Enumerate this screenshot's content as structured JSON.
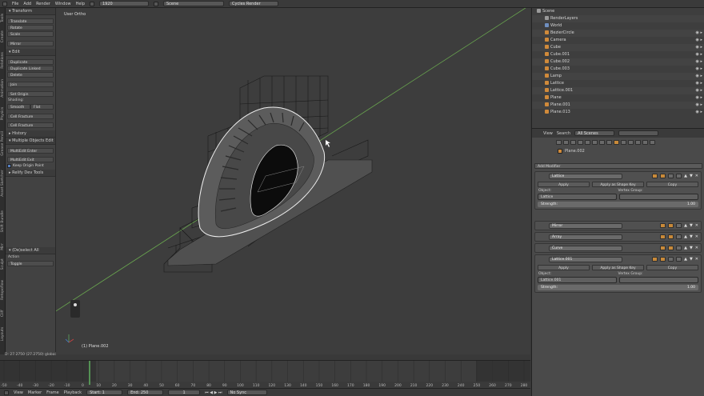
{
  "menu": {
    "items": [
      "File",
      "Add",
      "Render",
      "Window",
      "Help"
    ],
    "layout": "1920",
    "scene": "Scene",
    "engine": "Cycles Render"
  },
  "tabs": [
    "Tools",
    "Create",
    "Relations",
    "Animation",
    "Physics",
    "Grease Pencil",
    "Asset Sketcher",
    "Shift Bundle",
    "Mirr",
    "Sculpt",
    "Retopoflow",
    "Cliff",
    "Layouts",
    "Misc",
    "Layers"
  ],
  "shelf": {
    "transform": {
      "title": "Transform",
      "buttons": [
        "Translate",
        "Rotate",
        "Scale",
        "Mirror"
      ]
    },
    "edit": {
      "title": "Edit",
      "buttons": [
        "Duplicate",
        "Duplicate Linked",
        "Delete",
        "Join",
        "Set Origin"
      ],
      "shading_label": "Shading:",
      "smooth": "Smooth",
      "flat": "Flat",
      "fracture": [
        "Cell Fracture",
        "Cell Fracture"
      ]
    },
    "history": {
      "title": "History"
    },
    "multi": {
      "title": "Multiple Objects Edit",
      "buttons": [
        "MultiEdit Enter",
        "MultiEdit Exit"
      ],
      "check": "Keep Origin Point"
    },
    "relief": {
      "title": "Relify Dev Tools"
    },
    "dissolve": {
      "title": "(De)select All",
      "action_label": "Action",
      "action_value": "Toggle"
    }
  },
  "viewport": {
    "title": "User Ortho",
    "object_name": "(1) Plane.002",
    "coords": "D: 27.2750 (27.2750) global"
  },
  "timeline": {
    "ticks": [
      "-50",
      "-40",
      "-30",
      "-20",
      "-10",
      "0",
      "10",
      "20",
      "30",
      "40",
      "50",
      "60",
      "70",
      "80",
      "90",
      "100",
      "110",
      "120",
      "130",
      "140",
      "150",
      "160",
      "170",
      "180",
      "190",
      "200",
      "210",
      "220",
      "230",
      "240",
      "250",
      "260",
      "270",
      "280"
    ],
    "menu": [
      "View",
      "Marker",
      "Frame",
      "Playback"
    ],
    "start_label": "Start:",
    "start_value": "1",
    "end_label": "End:",
    "end_value": "250",
    "current": "1",
    "sync": "No Sync"
  },
  "outliner": {
    "items": [
      {
        "name": "Scene",
        "color": "#9a9a9a",
        "indent": 0
      },
      {
        "name": "RenderLayers",
        "color": "#9a9a9a",
        "indent": 1
      },
      {
        "name": "World",
        "color": "#6f8fc0",
        "indent": 1
      },
      {
        "name": "BezierCircle",
        "color": "#d08a3a",
        "indent": 1
      },
      {
        "name": "Camera",
        "color": "#d08a3a",
        "indent": 1
      },
      {
        "name": "Cube",
        "color": "#d08a3a",
        "indent": 1
      },
      {
        "name": "Cube.001",
        "color": "#d08a3a",
        "indent": 1
      },
      {
        "name": "Cube.002",
        "color": "#d08a3a",
        "indent": 1
      },
      {
        "name": "Cube.003",
        "color": "#d08a3a",
        "indent": 1
      },
      {
        "name": "Lamp",
        "color": "#d08a3a",
        "indent": 1
      },
      {
        "name": "Lattice",
        "color": "#d08a3a",
        "indent": 1
      },
      {
        "name": "Lattice.001",
        "color": "#d08a3a",
        "indent": 1
      },
      {
        "name": "Plane",
        "color": "#d08a3a",
        "indent": 1
      },
      {
        "name": "Plane.001",
        "color": "#d08a3a",
        "indent": 1
      },
      {
        "name": "Plane.013",
        "color": "#d08a3a",
        "indent": 1
      }
    ]
  },
  "propheader": {
    "view": "View",
    "search": "Search",
    "scenes": "All Scenes"
  },
  "props": {
    "object": "Plane.002",
    "add_modifier": "Add Modifier",
    "apply": "Apply",
    "apply_shape": "Apply as Shape Key",
    "copy": "Copy",
    "object_label": "Object:",
    "vgroup_label": "Vertex Group:",
    "strength_label": "Strength:",
    "strength_value": "1.00",
    "lattice1": {
      "name": "Lattice",
      "object": "Lattice"
    },
    "mirror": {
      "name": "Mirror"
    },
    "array": {
      "name": "Array"
    },
    "curve": {
      "name": "Curve"
    },
    "lattice2": {
      "name": "Lattice.001",
      "object": "Lattice.001"
    }
  }
}
